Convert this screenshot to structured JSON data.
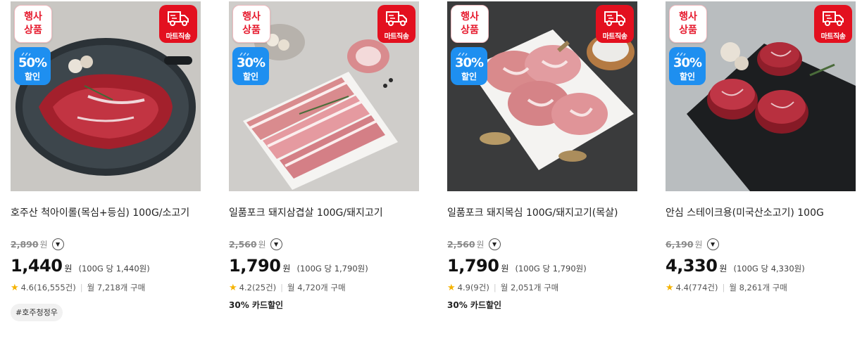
{
  "badges": {
    "event_line1": "행사",
    "event_line2": "상품",
    "discount_label": "할인",
    "mart_label": "마트직송",
    "truck_icon": "delivery-truck-icon"
  },
  "labels": {
    "won": "원",
    "dropdown_icon": "chevron-down-circle-icon",
    "star_icon": "star-icon"
  },
  "colors": {
    "event_red": "#e61b2e",
    "discount_blue": "#1e8ff0",
    "mart_red": "#e3101f",
    "star_gold": "#f5b301"
  },
  "products": [
    {
      "title": "호주산 척아이롤(목심+등심) 100G/소고기",
      "discount": "50%",
      "original_price": "2,890",
      "original_unit": "원",
      "price": "1,440",
      "unit_price": "(100G 당 1,440원)",
      "rating": "4.6(16,555건)",
      "monthly": "월 7,218개 구매",
      "tag": "#호주청정우"
    },
    {
      "title": "일품포크 돼지삼겹살 100G/돼지고기",
      "discount": "30%",
      "original_price": "2,560",
      "original_unit": "원",
      "price": "1,790",
      "unit_price": "(100G 당 1,790원)",
      "rating": "4.2(25건)",
      "monthly": "월 4,720개 구매",
      "benefit": "30% 카드할인"
    },
    {
      "title": "일품포크 돼지목심 100G/돼지고기(목살)",
      "discount": "30%",
      "original_price": "2,560",
      "original_unit": "원",
      "price": "1,790",
      "unit_price": "(100G 당 1,790원)",
      "rating": "4.9(9건)",
      "monthly": "월 2,051개 구매",
      "benefit": "30% 카드할인"
    },
    {
      "title": "안심 스테이크용(미국산소고기) 100G",
      "discount": "30%",
      "original_price": "6,190",
      "original_unit": "원",
      "price": "4,330",
      "unit_price": "(100G 당 4,330원)",
      "rating": "4.4(774건)",
      "monthly": "월 8,261개 구매"
    }
  ]
}
